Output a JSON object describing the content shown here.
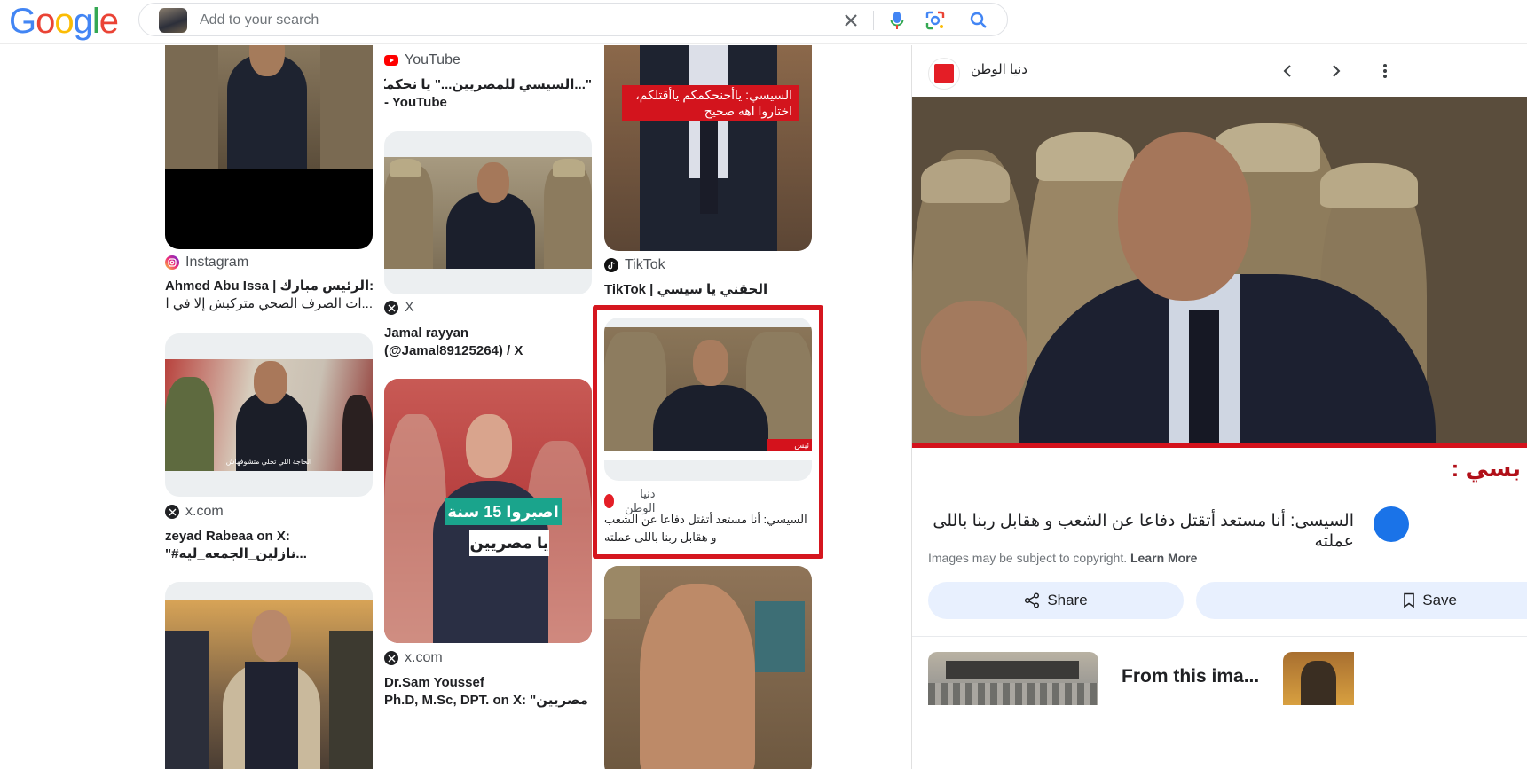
{
  "header": {
    "logo": "Google",
    "search_placeholder": "Add to your search"
  },
  "results": [
    {
      "source": "Instagram",
      "title": "Ahmed Abu Issa | الرئيس مبارك: ...ات الصرف الصحي متركبش إلا في الأخر،",
      "title_line1": "Ahmed Abu Issa | الرئيس مبارك:",
      "title_line2": "...ات الصرف الصحي متركبش إلا في الأخر،",
      "icon": "instagram-icon"
    },
    {
      "source": "x.com",
      "title_line1": "zeyad Rabeaa on X:",
      "title_line2": "\"#نازلين_الجمعه_ليه...",
      "icon": "x-icon",
      "overlay_text": "الحاجة اللي تخلي متشوفهاش"
    },
    {
      "source": "YouTube",
      "title_line1": "\"...السيسي للمصريين...\" يا نحكمكم..يا نقتلكم",
      "title_line2": "- YouTube",
      "icon": "youtube-icon"
    },
    {
      "source": "X",
      "title_line1": "Jamal rayyan",
      "title_line2": "(@Jamal89125264) / X",
      "icon": "x-icon"
    },
    {
      "source": "x.com",
      "title_line1": "Dr.Sam Youssef",
      "title_line2": "Ph.D, M.Sc, DPT. on X: \"يا مصريين...",
      "icon": "x-icon",
      "overlay_line1": "اصبروا 15 سنة",
      "overlay_line2": "يا مصريين"
    },
    {
      "source": "TikTok",
      "title_line1": "الحقني يا سيسي | TikTok",
      "icon": "tiktok-icon",
      "overlay_text": "السيسي: ياأحنحكمكم ياأقتلكم، اختاروا اهه صحيح"
    },
    {
      "source": "دنيا الوطن",
      "title_line1": "السيسي: أنا مستعد أتقتل دفاعا عن الشعب",
      "title_line2": "و هقابل ربنا باللى عملته",
      "icon": "dunya-alwatan-icon",
      "overlay_text": "ئيس السيسي :"
    }
  ],
  "panel": {
    "source_name": "دنيا الوطن",
    "title": "السيسى: أنا مستعد أتقتل دفاعا عن الشعب و هقابل ربنا باللى عملته",
    "copyright": "Images may be subject to copyright.",
    "learn_more": "Learn More",
    "share_label": "Share",
    "save_label": "Save",
    "from_title": "From this ima...",
    "overlay_text": "بسي :"
  }
}
